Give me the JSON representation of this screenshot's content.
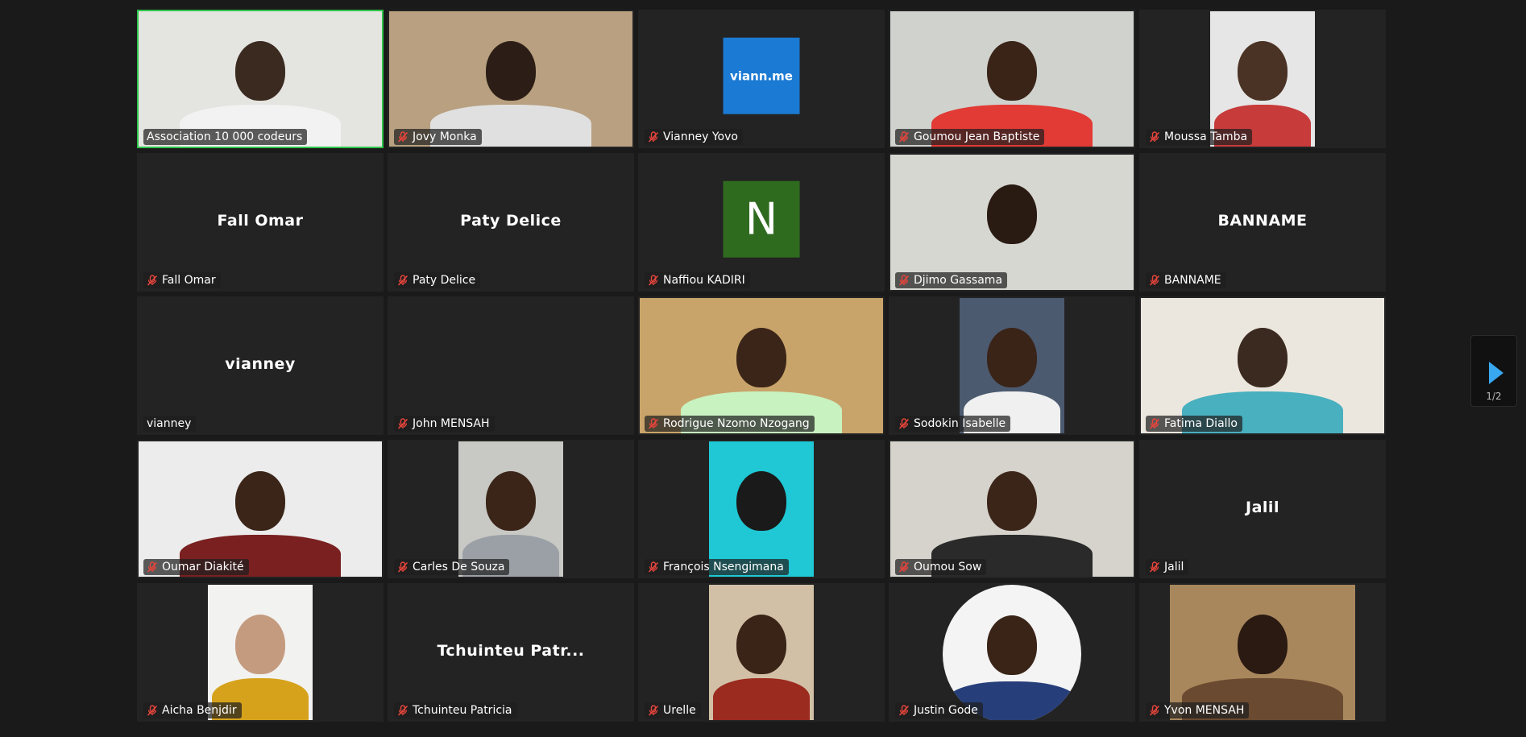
{
  "meeting": {
    "pagination": {
      "label": "1/2"
    },
    "colors": {
      "active_speaker_border": "#2ec44a",
      "muted_icon": "#e8453c",
      "next_arrow": "#39a7f0"
    },
    "participants": [
      {
        "name": "Association 10 000 codeurs",
        "muted": false,
        "active": true,
        "display": "video",
        "video_width": 300,
        "bg": "#e4e4e0",
        "skin": "#3a2a20",
        "shirt": "#f2f2f2"
      },
      {
        "name": "Jovy Monka",
        "muted": true,
        "display": "video",
        "video_width": 306,
        "bg": "#b8a080",
        "skin": "#2c1e16",
        "shirt": "#e0e0e0"
      },
      {
        "name": "Vianney Yovo",
        "muted": true,
        "display": "avatar",
        "avatar_text": "viann.me",
        "avatar_style": "viann"
      },
      {
        "name": "Goumou Jean Baptiste",
        "muted": true,
        "display": "video",
        "video_width": 302,
        "bg": "#cfd2cd",
        "skin": "#3a2418",
        "shirt": "#e23a35"
      },
      {
        "name": "Moussa Tamba",
        "muted": true,
        "display": "video",
        "video_width": 130,
        "bg": "#e6e6e6",
        "skin": "#4a3325",
        "shirt": "#c73b3b"
      },
      {
        "name": "Fall  Omar",
        "muted": true,
        "display": "name",
        "center_text": "Fall  Omar"
      },
      {
        "name": "Paty Delice",
        "muted": true,
        "display": "name",
        "center_text": "Paty Delice"
      },
      {
        "name": "Naffiou KADIRI",
        "muted": true,
        "display": "avatar",
        "avatar_text": "N",
        "avatar_style": "letter"
      },
      {
        "name": "Djimo Gassama",
        "muted": true,
        "display": "video",
        "video_width": 306,
        "bg": "#d7d7d2",
        "skin": "#2a1b12",
        "shirt": "#d7d7d2"
      },
      {
        "name": "BANNAME",
        "muted": true,
        "display": "name",
        "center_text": "BANNAME"
      },
      {
        "name": "vianney",
        "muted": false,
        "display": "name",
        "center_text": "vianney"
      },
      {
        "name": "John MENSAH",
        "muted": true,
        "display": "blank"
      },
      {
        "name": "Rodrigue Nzomo Nzogang",
        "muted": true,
        "display": "video",
        "video_width": 306,
        "bg": "#c9a46a",
        "skin": "#3b2519",
        "shirt": "#c8f2c0"
      },
      {
        "name": "Sodokin Isabelle",
        "muted": true,
        "display": "video",
        "video_width": 130,
        "bg": "#4c5a70",
        "skin": "#3a2418",
        "shirt": "#f0f0f0"
      },
      {
        "name": "Fatima Diallo",
        "muted": true,
        "display": "video",
        "video_width": 306,
        "bg": "#ece7de",
        "skin": "#3b2a20",
        "shirt": "#48b0bf"
      },
      {
        "name": "Oumar Diakité",
        "muted": true,
        "display": "video",
        "video_width": 306,
        "bg": "#ececec",
        "skin": "#3a2518",
        "shirt": "#7a2020"
      },
      {
        "name": "Carles De Souza",
        "muted": true,
        "display": "video",
        "video_width": 130,
        "bg": "#c8c8c4",
        "skin": "#3a2518",
        "shirt": "#9aa0a6"
      },
      {
        "name": "François Nsengimana",
        "muted": true,
        "display": "video",
        "video_width": 130,
        "bg": "#1fc8d4",
        "skin": "#1a1a1a",
        "shirt": "#1fc8d4"
      },
      {
        "name": "Oumou Sow",
        "muted": true,
        "display": "video",
        "video_width": 306,
        "bg": "#d6d2cc",
        "skin": "#3b2519",
        "shirt": "#2a2a2a"
      },
      {
        "name": "Jalil",
        "muted": true,
        "display": "name",
        "center_text": "Jalil"
      },
      {
        "name": "Aicha Benjdir",
        "muted": true,
        "display": "video",
        "video_width": 130,
        "bg": "#f2f2f0",
        "skin": "#c59b7f",
        "shirt": "#d6a21c"
      },
      {
        "name": "Tchuinteu Patricia",
        "muted": true,
        "display": "name",
        "center_text": "Tchuinteu Patr..."
      },
      {
        "name": "Urelle",
        "muted": true,
        "display": "video",
        "video_width": 130,
        "bg": "#d2c0a6",
        "skin": "#3a2418",
        "shirt": "#9b2a1f"
      },
      {
        "name": "Justin Gode",
        "muted": true,
        "display": "video",
        "video_width": 172,
        "round": true,
        "bg": "#f4f4f4",
        "skin": "#3a2418",
        "shirt": "#263e7a"
      },
      {
        "name": "Yvon MENSAH",
        "muted": true,
        "display": "video",
        "video_width": 230,
        "bg": "#a9875c",
        "skin": "#2a1a12",
        "shirt": "#6a4a30"
      }
    ]
  }
}
